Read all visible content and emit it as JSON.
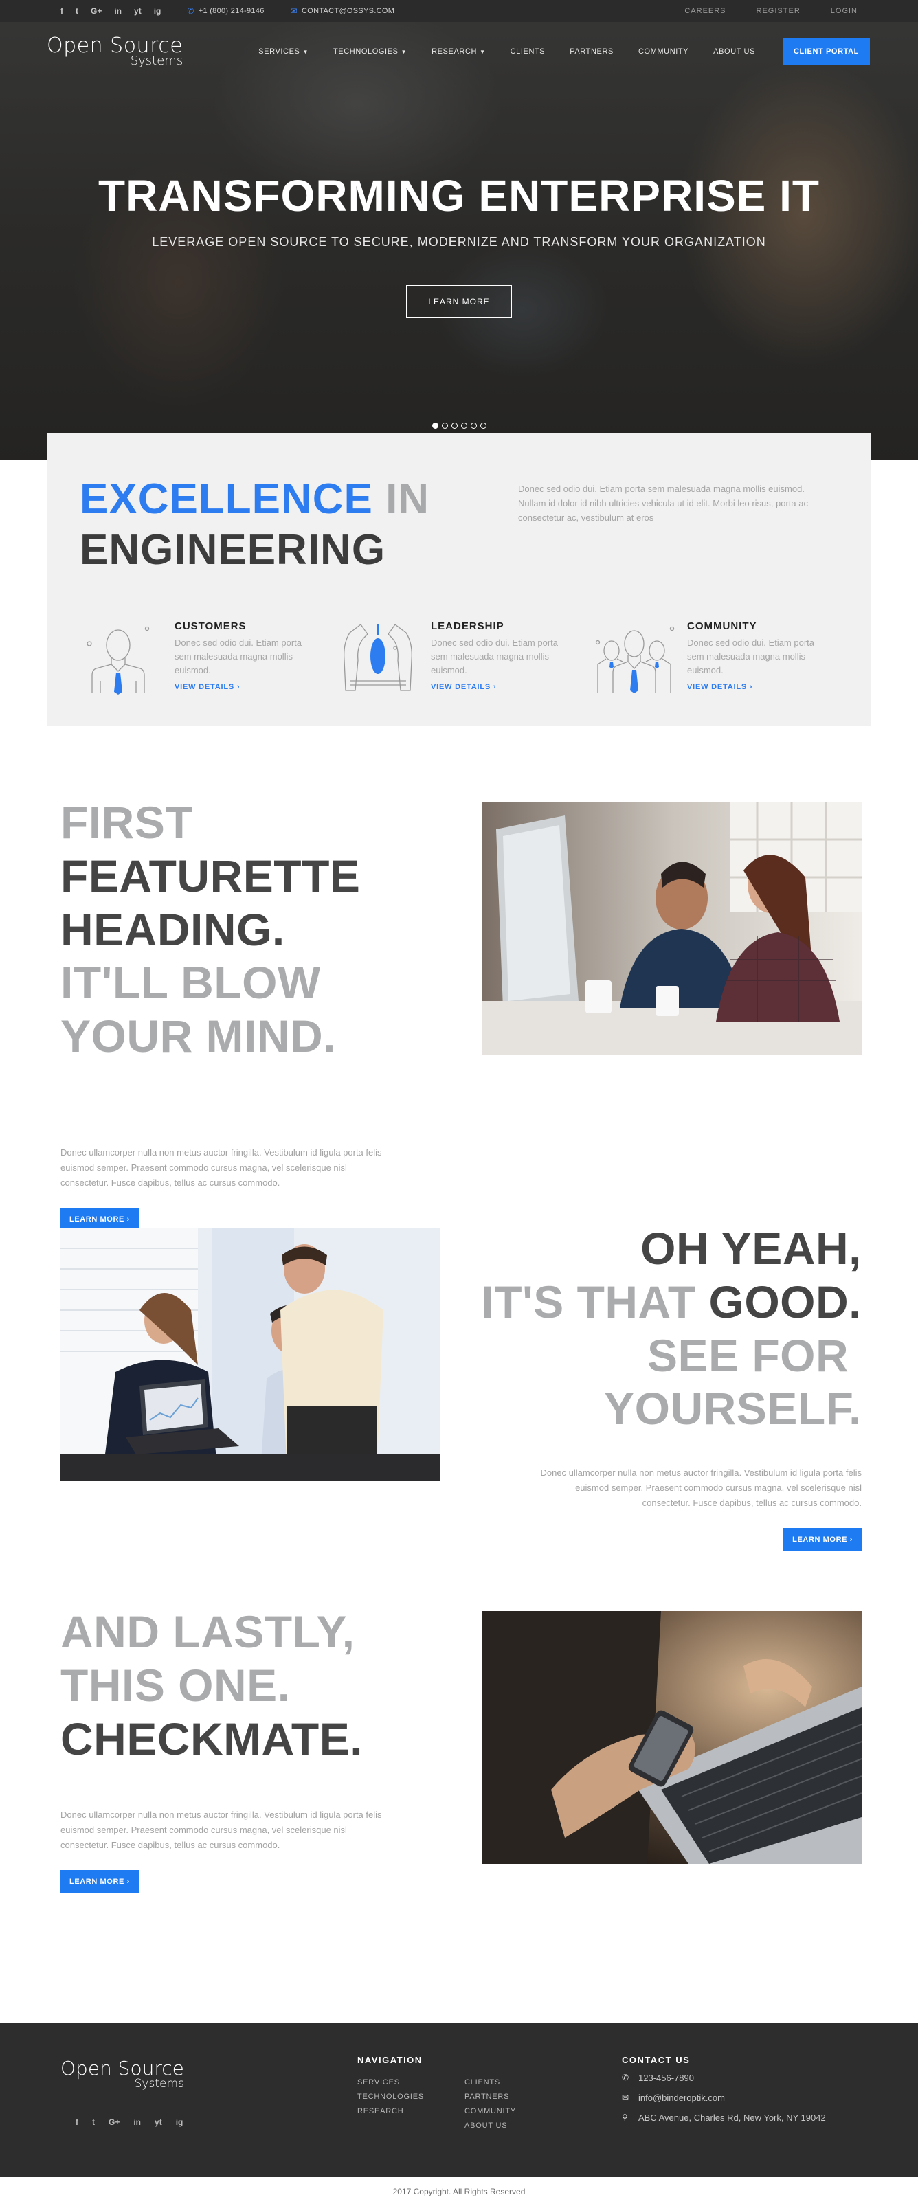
{
  "topbar": {
    "social": [
      "f",
      "t",
      "G+",
      "in",
      "yt",
      "ig"
    ],
    "social_icons": [
      "facebook-icon",
      "twitter-icon",
      "google-plus-icon",
      "linkedin-icon",
      "youtube-icon",
      "instagram-icon"
    ],
    "phone": "+1 (800) 214-9146",
    "email": "CONTACT@OSSYS.COM",
    "links": [
      "CAREERS",
      "REGISTER",
      "LOGIN"
    ]
  },
  "logo": {
    "line1": "Open Source",
    "line2": "Systems"
  },
  "nav": {
    "items": [
      "SERVICES",
      "TECHNOLOGIES",
      "RESEARCH",
      "CLIENTS",
      "PARTNERS",
      "COMMUNITY",
      "ABOUT US"
    ],
    "portal": "CLIENT PORTAL"
  },
  "hero": {
    "title": "TRANSFORMING ENTERPRISE IT",
    "subtitle": "LEVERAGE OPEN SOURCE TO SECURE, MODERNIZE AND TRANSFORM YOUR ORGANIZATION",
    "button": "LEARN MORE",
    "slides": 6,
    "active_slide": 1
  },
  "excellence": {
    "word1": "EXCELLENCE",
    "word2": "IN",
    "word3": "ENGINEERING",
    "description": "Donec sed odio dui. Etiam porta sem malesuada magna mollis euismod. Nullam id dolor id nibh ultricies vehicula ut id elit. Morbi leo risus, porta ac consectetur ac, vestibulum at eros",
    "features": [
      {
        "title": "CUSTOMERS",
        "text": "Donec sed odio dui. Etiam porta sem malesuada magna mollis euismod.",
        "link": "VIEW DETAILS ›"
      },
      {
        "title": "LEADERSHIP",
        "text": "Donec sed odio dui. Etiam porta sem malesuada magna mollis euismod.",
        "link": "VIEW DETAILS ›"
      },
      {
        "title": "COMMUNITY",
        "text": "Donec sed odio dui. Etiam porta sem malesuada magna mollis euismod.",
        "link": "VIEW DETAILS ›"
      }
    ]
  },
  "featurette1": {
    "line1": "FIRST",
    "line2": "FEATURETTE",
    "line3": "HEADING.",
    "line4": "IT'LL BLOW",
    "line5": "YOUR MIND.",
    "text": "Donec ullamcorper nulla non metus auctor fringilla. Vestibulum id ligula porta felis euismod semper. Praesent commodo cursus magna, vel scelerisque nisl consectetur. Fusce dapibus, tellus ac cursus commodo.",
    "button": "LEARN MORE ›"
  },
  "featurette2": {
    "line1": "OH YEAH,",
    "line2a": "IT'S THAT ",
    "line2b": "GOOD.",
    "line3": "SEE FOR",
    "line4": "YOURSELF.",
    "text": "Donec ullamcorper nulla non metus auctor fringilla. Vestibulum id ligula porta felis euismod semper. Praesent commodo cursus magna, vel scelerisque nisl consectetur. Fusce dapibus, tellus ac cursus commodo.",
    "button": "LEARN MORE ›"
  },
  "featurette3": {
    "line1": "AND LASTLY,",
    "line2": "THIS ONE.",
    "line3": "CHECKMATE.",
    "text": "Donec ullamcorper nulla non metus auctor fringilla. Vestibulum id ligula porta felis euismod semper. Praesent commodo cursus magna, vel scelerisque nisl consectetur. Fusce dapibus, tellus ac cursus commodo.",
    "button": "LEARN MORE ›"
  },
  "footer": {
    "nav_title": "NAVIGATION",
    "nav_col1": [
      "SERVICES",
      "TECHNOLOGIES",
      "RESEARCH"
    ],
    "nav_col2": [
      "CLIENTS",
      "PARTNERS",
      "COMMUNITY",
      "ABOUT US"
    ],
    "contact_title": "CONTACT US",
    "phone": "123-456-7890",
    "email": "info@binderoptik.com",
    "address": "ABC Avenue, Charles Rd, New York, NY 19042",
    "copyright": "2017 Copyright. All Rights Reserved"
  },
  "colors": {
    "accent": "#1f7bf2",
    "dark": "#2b2b2b",
    "heading_grey": "#a9abad",
    "heading_dark": "#454545"
  }
}
